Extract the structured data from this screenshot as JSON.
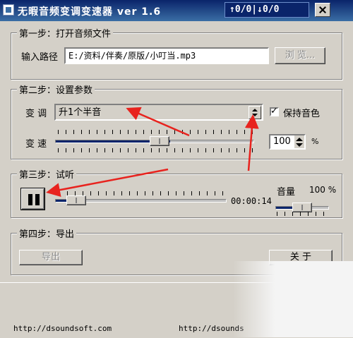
{
  "window": {
    "title": "无暇音频变调变速器 ver 1.6",
    "counter_text": "↑0/0|↓0/0"
  },
  "step1": {
    "title": "第一步：打开音频文件",
    "path_label": "输入路径",
    "path_value": "E:/资料/伴奏/原版/小叮当.mp3",
    "browse_label": "浏 览..."
  },
  "step2": {
    "title": "第二步：设置参数",
    "pitch_label": "变 调",
    "pitch_value": "升1个半音",
    "keep_timbre_label": "保持音色",
    "keep_timbre_checked": true,
    "speed_label": "变 速",
    "speed_value": "100",
    "speed_unit": "%",
    "speed_slider_level": 0.58
  },
  "step3": {
    "title": "第三步：试听",
    "time": "00:00:14",
    "volume_label": "音量",
    "volume_value": "100 %",
    "playback_level": 0.08,
    "volume_level": 0.55
  },
  "step4": {
    "title": "第四步：导出",
    "export_label": "导出",
    "about_label": "关  于"
  },
  "footer": {
    "url_left": "http://dsoundsoft.com",
    "url_right": "http://dsounds"
  },
  "colors": {
    "titlebar": "#0a246a",
    "annotation_arrow": "#e8231e",
    "face": "#d4d0c8"
  }
}
